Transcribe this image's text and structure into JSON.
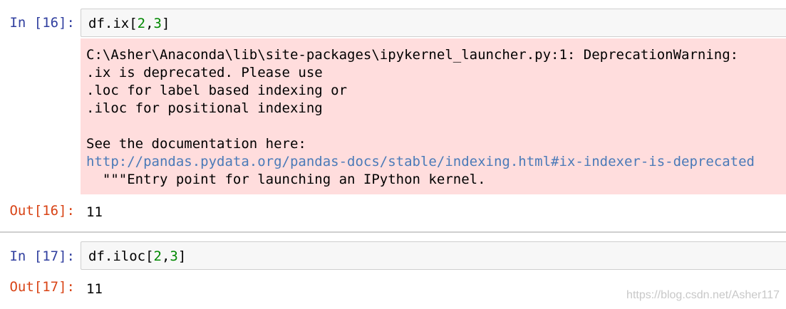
{
  "cells": [
    {
      "in_prompt": "In [16]:",
      "code": {
        "prefix": "df.ix[",
        "arg1": "2",
        "sep": ",",
        "arg2": "3",
        "suffix": "]"
      },
      "stderr": {
        "lines": [
          "C:\\Asher\\Anaconda\\lib\\site-packages\\ipykernel_launcher.py:1: DeprecationWarning:",
          ".ix is deprecated. Please use",
          ".loc for label based indexing or",
          ".iloc for positional indexing",
          "See the documentation here:"
        ],
        "link": "http://pandas.pydata.org/pandas-docs/stable/indexing.html#ix-indexer-is-deprecated",
        "last_line": "  \"\"\"Entry point for launching an IPython kernel."
      },
      "out_prompt": "Out[16]:",
      "output": "11"
    },
    {
      "in_prompt": "In [17]:",
      "code": {
        "prefix": "df.iloc[",
        "arg1": "2",
        "sep": ",",
        "arg2": "3",
        "suffix": "]"
      },
      "out_prompt": "Out[17]:",
      "output": "11"
    }
  ],
  "watermark": "https://blog.csdn.net/Asher117",
  "colors": {
    "in_prompt": "#303f9f",
    "out_prompt": "#d84315",
    "stderr_bg": "#ffdddd",
    "input_bg": "#f7f7f7",
    "number": "#008800",
    "link": "#4a7ab8"
  }
}
